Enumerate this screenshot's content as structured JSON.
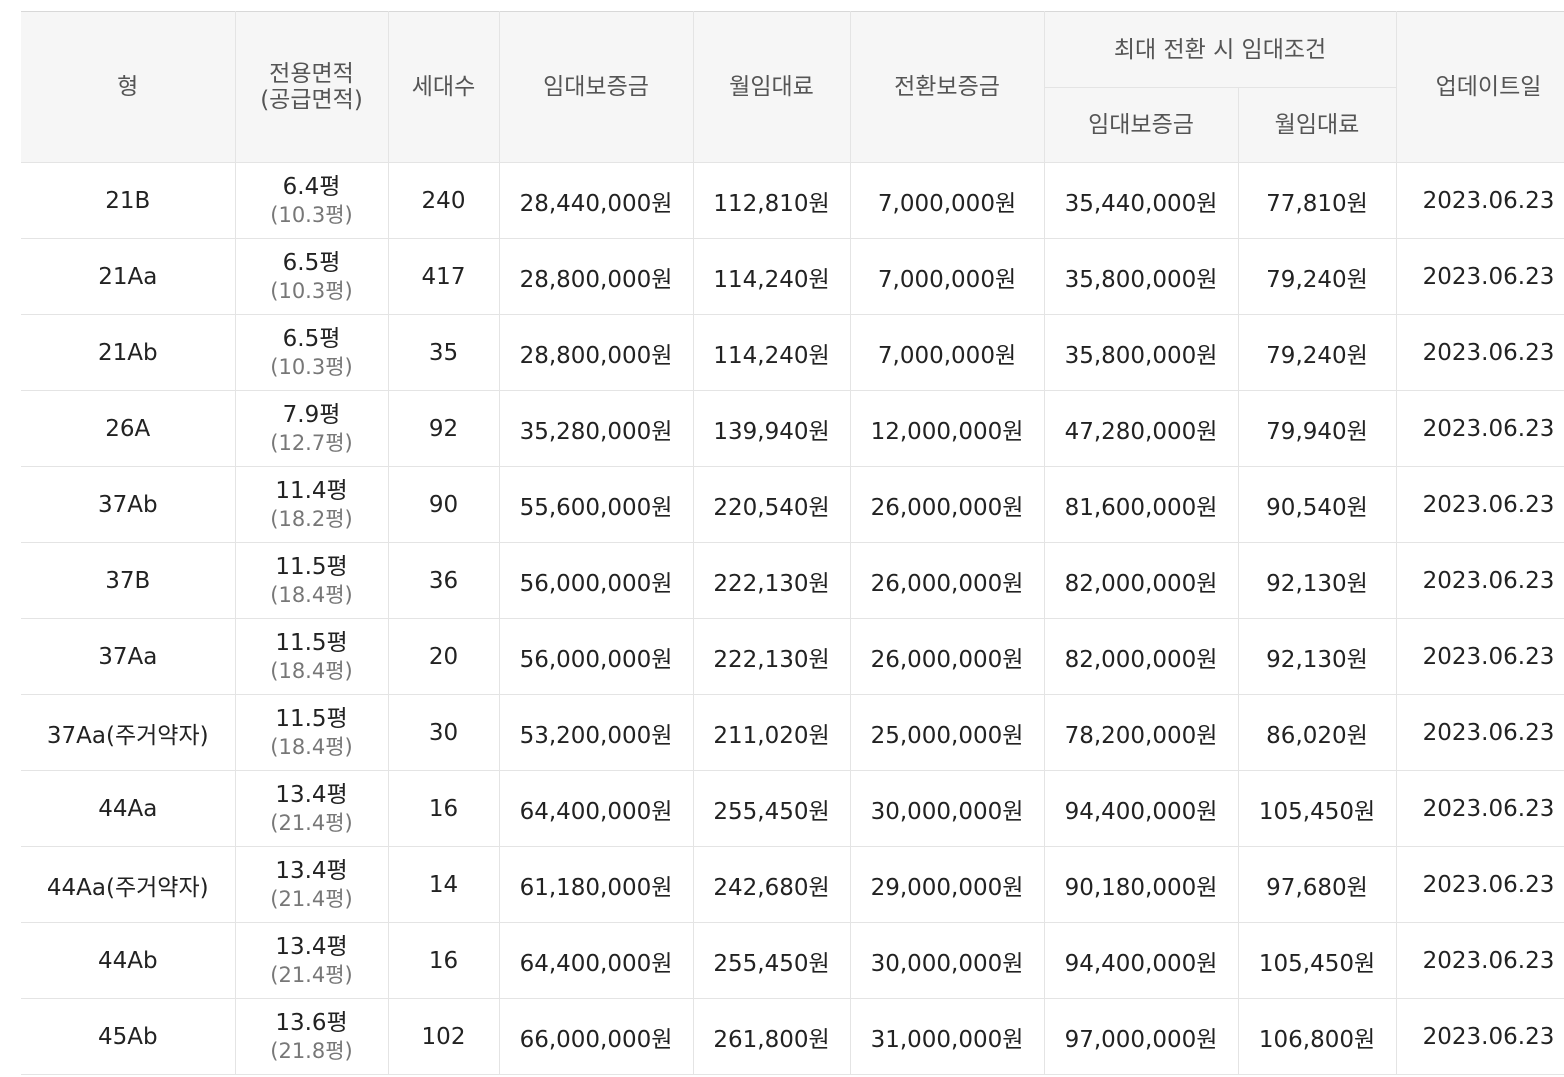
{
  "headers": {
    "type": "형",
    "area_line1": "전용면적",
    "area_line2": "(공급면적)",
    "units": "세대수",
    "deposit": "임대보증금",
    "monthly_rent": "월임대료",
    "conversion_deposit": "전환보증금",
    "max_conversion_group": "최대 전환 시 임대조건",
    "max_deposit": "임대보증금",
    "max_monthly_rent": "월임대료",
    "update_date": "업데이트일"
  },
  "rows": [
    {
      "type": "21B",
      "area": "6.4평",
      "supply_area": "(10.3평)",
      "units": "240",
      "deposit": "28,440,000원",
      "rent": "112,810원",
      "conv": "7,000,000원",
      "max_deposit": "35,440,000원",
      "max_rent": "77,810원",
      "date": "2023.06.23"
    },
    {
      "type": "21Aa",
      "area": "6.5평",
      "supply_area": "(10.3평)",
      "units": "417",
      "deposit": "28,800,000원",
      "rent": "114,240원",
      "conv": "7,000,000원",
      "max_deposit": "35,800,000원",
      "max_rent": "79,240원",
      "date": "2023.06.23"
    },
    {
      "type": "21Ab",
      "area": "6.5평",
      "supply_area": "(10.3평)",
      "units": "35",
      "deposit": "28,800,000원",
      "rent": "114,240원",
      "conv": "7,000,000원",
      "max_deposit": "35,800,000원",
      "max_rent": "79,240원",
      "date": "2023.06.23"
    },
    {
      "type": "26A",
      "area": "7.9평",
      "supply_area": "(12.7평)",
      "units": "92",
      "deposit": "35,280,000원",
      "rent": "139,940원",
      "conv": "12,000,000원",
      "max_deposit": "47,280,000원",
      "max_rent": "79,940원",
      "date": "2023.06.23"
    },
    {
      "type": "37Ab",
      "area": "11.4평",
      "supply_area": "(18.2평)",
      "units": "90",
      "deposit": "55,600,000원",
      "rent": "220,540원",
      "conv": "26,000,000원",
      "max_deposit": "81,600,000원",
      "max_rent": "90,540원",
      "date": "2023.06.23"
    },
    {
      "type": "37B",
      "area": "11.5평",
      "supply_area": "(18.4평)",
      "units": "36",
      "deposit": "56,000,000원",
      "rent": "222,130원",
      "conv": "26,000,000원",
      "max_deposit": "82,000,000원",
      "max_rent": "92,130원",
      "date": "2023.06.23"
    },
    {
      "type": "37Aa",
      "area": "11.5평",
      "supply_area": "(18.4평)",
      "units": "20",
      "deposit": "56,000,000원",
      "rent": "222,130원",
      "conv": "26,000,000원",
      "max_deposit": "82,000,000원",
      "max_rent": "92,130원",
      "date": "2023.06.23"
    },
    {
      "type": "37Aa(주거약자)",
      "area": "11.5평",
      "supply_area": "(18.4평)",
      "units": "30",
      "deposit": "53,200,000원",
      "rent": "211,020원",
      "conv": "25,000,000원",
      "max_deposit": "78,200,000원",
      "max_rent": "86,020원",
      "date": "2023.06.23"
    },
    {
      "type": "44Aa",
      "area": "13.4평",
      "supply_area": "(21.4평)",
      "units": "16",
      "deposit": "64,400,000원",
      "rent": "255,450원",
      "conv": "30,000,000원",
      "max_deposit": "94,400,000원",
      "max_rent": "105,450원",
      "date": "2023.06.23"
    },
    {
      "type": "44Aa(주거약자)",
      "area": "13.4평",
      "supply_area": "(21.4평)",
      "units": "14",
      "deposit": "61,180,000원",
      "rent": "242,680원",
      "conv": "29,000,000원",
      "max_deposit": "90,180,000원",
      "max_rent": "97,680원",
      "date": "2023.06.23"
    },
    {
      "type": "44Ab",
      "area": "13.4평",
      "supply_area": "(21.4평)",
      "units": "16",
      "deposit": "64,400,000원",
      "rent": "255,450원",
      "conv": "30,000,000원",
      "max_deposit": "94,400,000원",
      "max_rent": "105,450원",
      "date": "2023.06.23"
    },
    {
      "type": "45Ab",
      "area": "13.6평",
      "supply_area": "(21.8평)",
      "units": "102",
      "deposit": "66,000,000원",
      "rent": "261,800원",
      "conv": "31,000,000원",
      "max_deposit": "97,000,000원",
      "max_rent": "106,800원",
      "date": "2023.06.23"
    }
  ]
}
